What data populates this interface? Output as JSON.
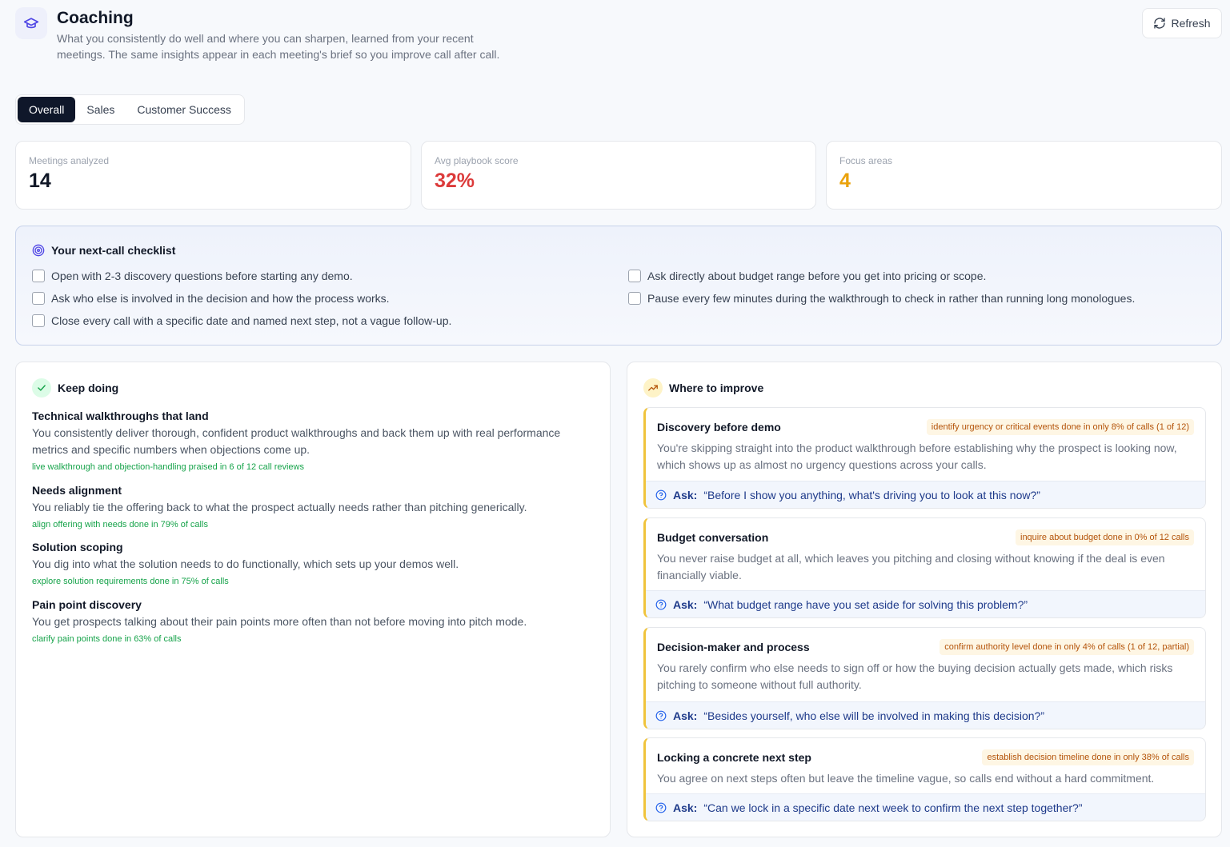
{
  "header": {
    "title": "Coaching",
    "subtitle": "What you consistently do well and where you can sharpen, learned from your recent meetings. The same insights appear in each meeting's brief so you improve call after call.",
    "icon": "graduation-cap-icon",
    "refresh_label": "Refresh"
  },
  "tabs": [
    {
      "label": "Overall",
      "active": true
    },
    {
      "label": "Sales",
      "active": false
    },
    {
      "label": "Customer Success",
      "active": false
    }
  ],
  "stats": [
    {
      "label": "Meetings analyzed",
      "value": "14",
      "color": "#111827"
    },
    {
      "label": "Avg playbook score",
      "value": "32%",
      "color": "#dc3b3b"
    },
    {
      "label": "Focus areas",
      "value": "4",
      "color": "#eaa20b"
    }
  ],
  "checklist": {
    "title": "Your next-call checklist",
    "items": [
      "Open with 2-3 discovery questions before starting any demo.",
      "Ask who else is involved in the decision and how the process works.",
      "Close every call with a specific date and named next step, not a vague follow-up.",
      "Ask directly about budget range before you get into pricing or scope.",
      "Pause every few minutes during the walkthrough to check in rather than running long monologues."
    ]
  },
  "keep_doing": {
    "title": "Keep doing",
    "items": [
      {
        "title": "Technical walkthroughs that land",
        "text": "You consistently deliver thorough, confident product walkthroughs and back them up with real performance metrics and specific numbers when objections come up.",
        "evidence": "live walkthrough and objection-handling praised in 6 of 12 call reviews"
      },
      {
        "title": "Needs alignment",
        "text": "You reliably tie the offering back to what the prospect actually needs rather than pitching generically.",
        "evidence": "align offering with needs done in 79% of calls"
      },
      {
        "title": "Solution scoping",
        "text": "You dig into what the solution needs to do functionally, which sets up your demos well.",
        "evidence": "explore solution requirements done in 75% of calls"
      },
      {
        "title": "Pain point discovery",
        "text": "You get prospects talking about their pain points more often than not before moving into pitch mode.",
        "evidence": "clarify pain points done in 63% of calls"
      }
    ]
  },
  "improve": {
    "title": "Where to improve",
    "ask_label": "Ask:",
    "items": [
      {
        "title": "Discovery before demo",
        "badge": "identify urgency or critical events done in only 8% of calls (1 of 12)",
        "text": "You're skipping straight into the product walkthrough before establishing why the prospect is looking now, which shows up as almost no urgency questions across your calls.",
        "ask": "“Before I show you anything, what's driving you to look at this now?”"
      },
      {
        "title": "Budget conversation",
        "badge": "inquire about budget done in 0% of 12 calls",
        "text": "You never raise budget at all, which leaves you pitching and closing without knowing if the deal is even financially viable.",
        "ask": "“What budget range have you set aside for solving this problem?”"
      },
      {
        "title": "Decision-maker and process",
        "badge": "confirm authority level done in only 4% of calls (1 of 12, partial)",
        "text": "You rarely confirm who else needs to sign off or how the buying decision actually gets made, which risks pitching to someone without full authority.",
        "ask": "“Besides yourself, who else will be involved in making this decision?”"
      },
      {
        "title": "Locking a concrete next step",
        "badge": "establish decision timeline done in only 38% of calls",
        "text": "You agree on next steps often but leave the timeline vague, so calls end without a hard commitment.",
        "ask": "“Can we lock in a specific date next week to confirm the next step together?”"
      }
    ]
  }
}
